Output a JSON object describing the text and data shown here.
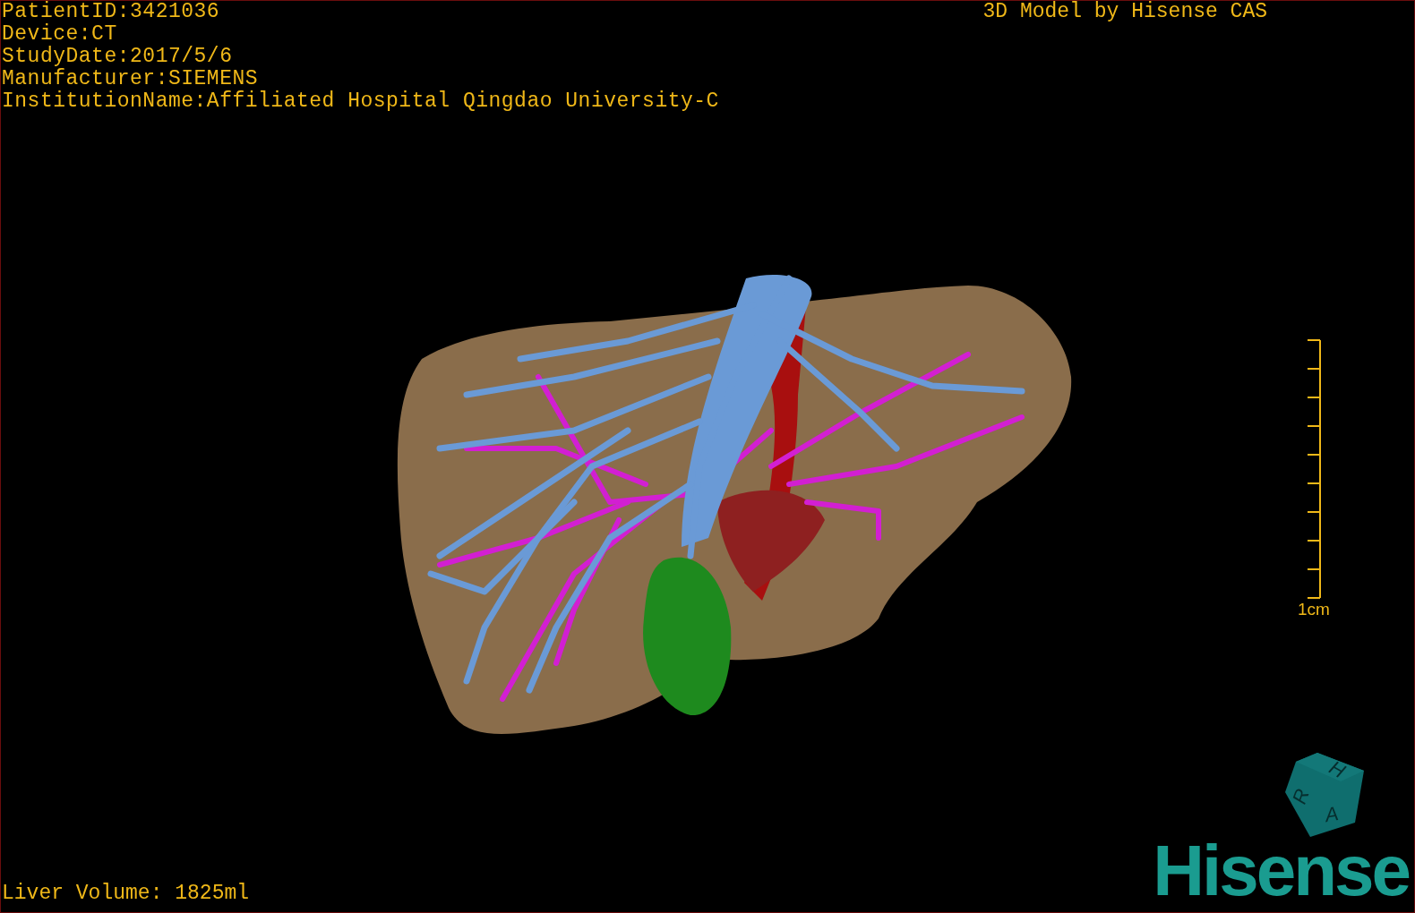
{
  "overlay": {
    "patient_info": [
      "PatientID:3421036",
      "Device:CT",
      "StudyDate:2017/5/6",
      "Manufacturer:SIEMENS",
      "InstitutionName:Affiliated Hospital Qingdao University-C"
    ],
    "title": "3D Model by Hisense CAS",
    "liver_volume": "Liver Volume: 1825ml"
  },
  "scale_bar": {
    "label": "1cm"
  },
  "orientation_cube": {
    "faces": [
      "H",
      "R",
      "A"
    ]
  },
  "logo": {
    "text": "Hisense"
  }
}
